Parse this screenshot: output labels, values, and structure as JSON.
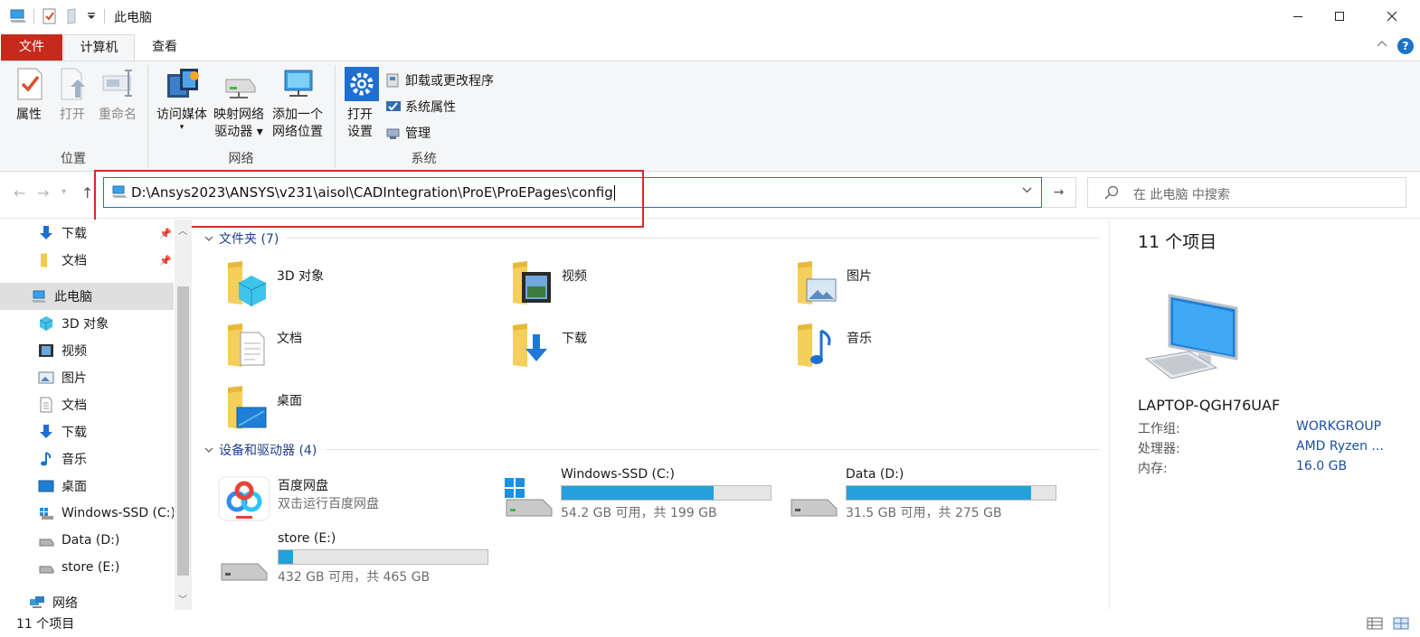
{
  "window": {
    "title": "此电脑"
  },
  "ribbon_tabs": {
    "file": "文件",
    "computer": "计算机",
    "view": "查看"
  },
  "help_label": "?",
  "ribbon": {
    "location": {
      "label": "位置",
      "properties": "属性",
      "open": "打开",
      "rename": "重命名"
    },
    "network": {
      "label": "网络",
      "access_media": "访问媒体",
      "map_drive_1": "映射网络",
      "map_drive_2": "驱动器",
      "add_location_1": "添加一个",
      "add_location_2": "网络位置"
    },
    "system": {
      "label": "系统",
      "open_settings_1": "打开",
      "open_settings_2": "设置",
      "uninstall": "卸载或更改程序",
      "system_properties": "系统属性",
      "manage": "管理"
    }
  },
  "address_bar": {
    "path": "D:\\Ansys2023\\ANSYS\\v231\\aisol\\CADIntegration\\ProE\\ProEPages\\config",
    "search_placeholder": "在 此电脑 中搜索"
  },
  "nav_pane": {
    "quick_items": [
      {
        "label": "下载"
      },
      {
        "label": "文档"
      }
    ],
    "this_pc": "此电脑",
    "pc_items": [
      {
        "label": "3D 对象"
      },
      {
        "label": "视频"
      },
      {
        "label": "图片"
      },
      {
        "label": "文档"
      },
      {
        "label": "下载"
      },
      {
        "label": "音乐"
      },
      {
        "label": "桌面"
      },
      {
        "label": "Windows-SSD (C:)"
      },
      {
        "label": "Data (D:)"
      },
      {
        "label": "store (E:)"
      }
    ],
    "network": "网络"
  },
  "content": {
    "folders_header": "文件夹 (7)",
    "folders": [
      {
        "label": "3D 对象"
      },
      {
        "label": "视频"
      },
      {
        "label": "图片"
      },
      {
        "label": "文档"
      },
      {
        "label": "下载"
      },
      {
        "label": "音乐"
      },
      {
        "label": "桌面"
      }
    ],
    "devices_header": "设备和驱动器 (4)",
    "baidu": {
      "name": "百度网盘",
      "subtitle": "双击运行百度网盘"
    },
    "drives": [
      {
        "name": "Windows-SSD (C:)",
        "free_text": "54.2 GB 可用，共 199 GB",
        "used_fraction": 0.728
      },
      {
        "name": "Data (D:)",
        "free_text": "31.5 GB 可用，共 275 GB",
        "used_fraction": 0.885
      },
      {
        "name": "store (E:)",
        "free_text": "432 GB 可用，共 465 GB",
        "used_fraction": 0.071
      }
    ]
  },
  "details": {
    "count": "11 个项目",
    "computer_name": "LAPTOP-QGH76UAF",
    "rows": [
      {
        "key": "工作组:",
        "value": "WORKGROUP"
      },
      {
        "key": "处理器:",
        "value": "AMD Ryzen ..."
      },
      {
        "key": "内存:",
        "value": "16.0 GB"
      }
    ]
  },
  "status_bar": {
    "count": "11 个项目"
  },
  "colors": {
    "file_tab": "#c42b1c",
    "accent": "#1f6fd1",
    "drive_bar": "#26a0da",
    "highlight_box": "#d42b2b"
  }
}
